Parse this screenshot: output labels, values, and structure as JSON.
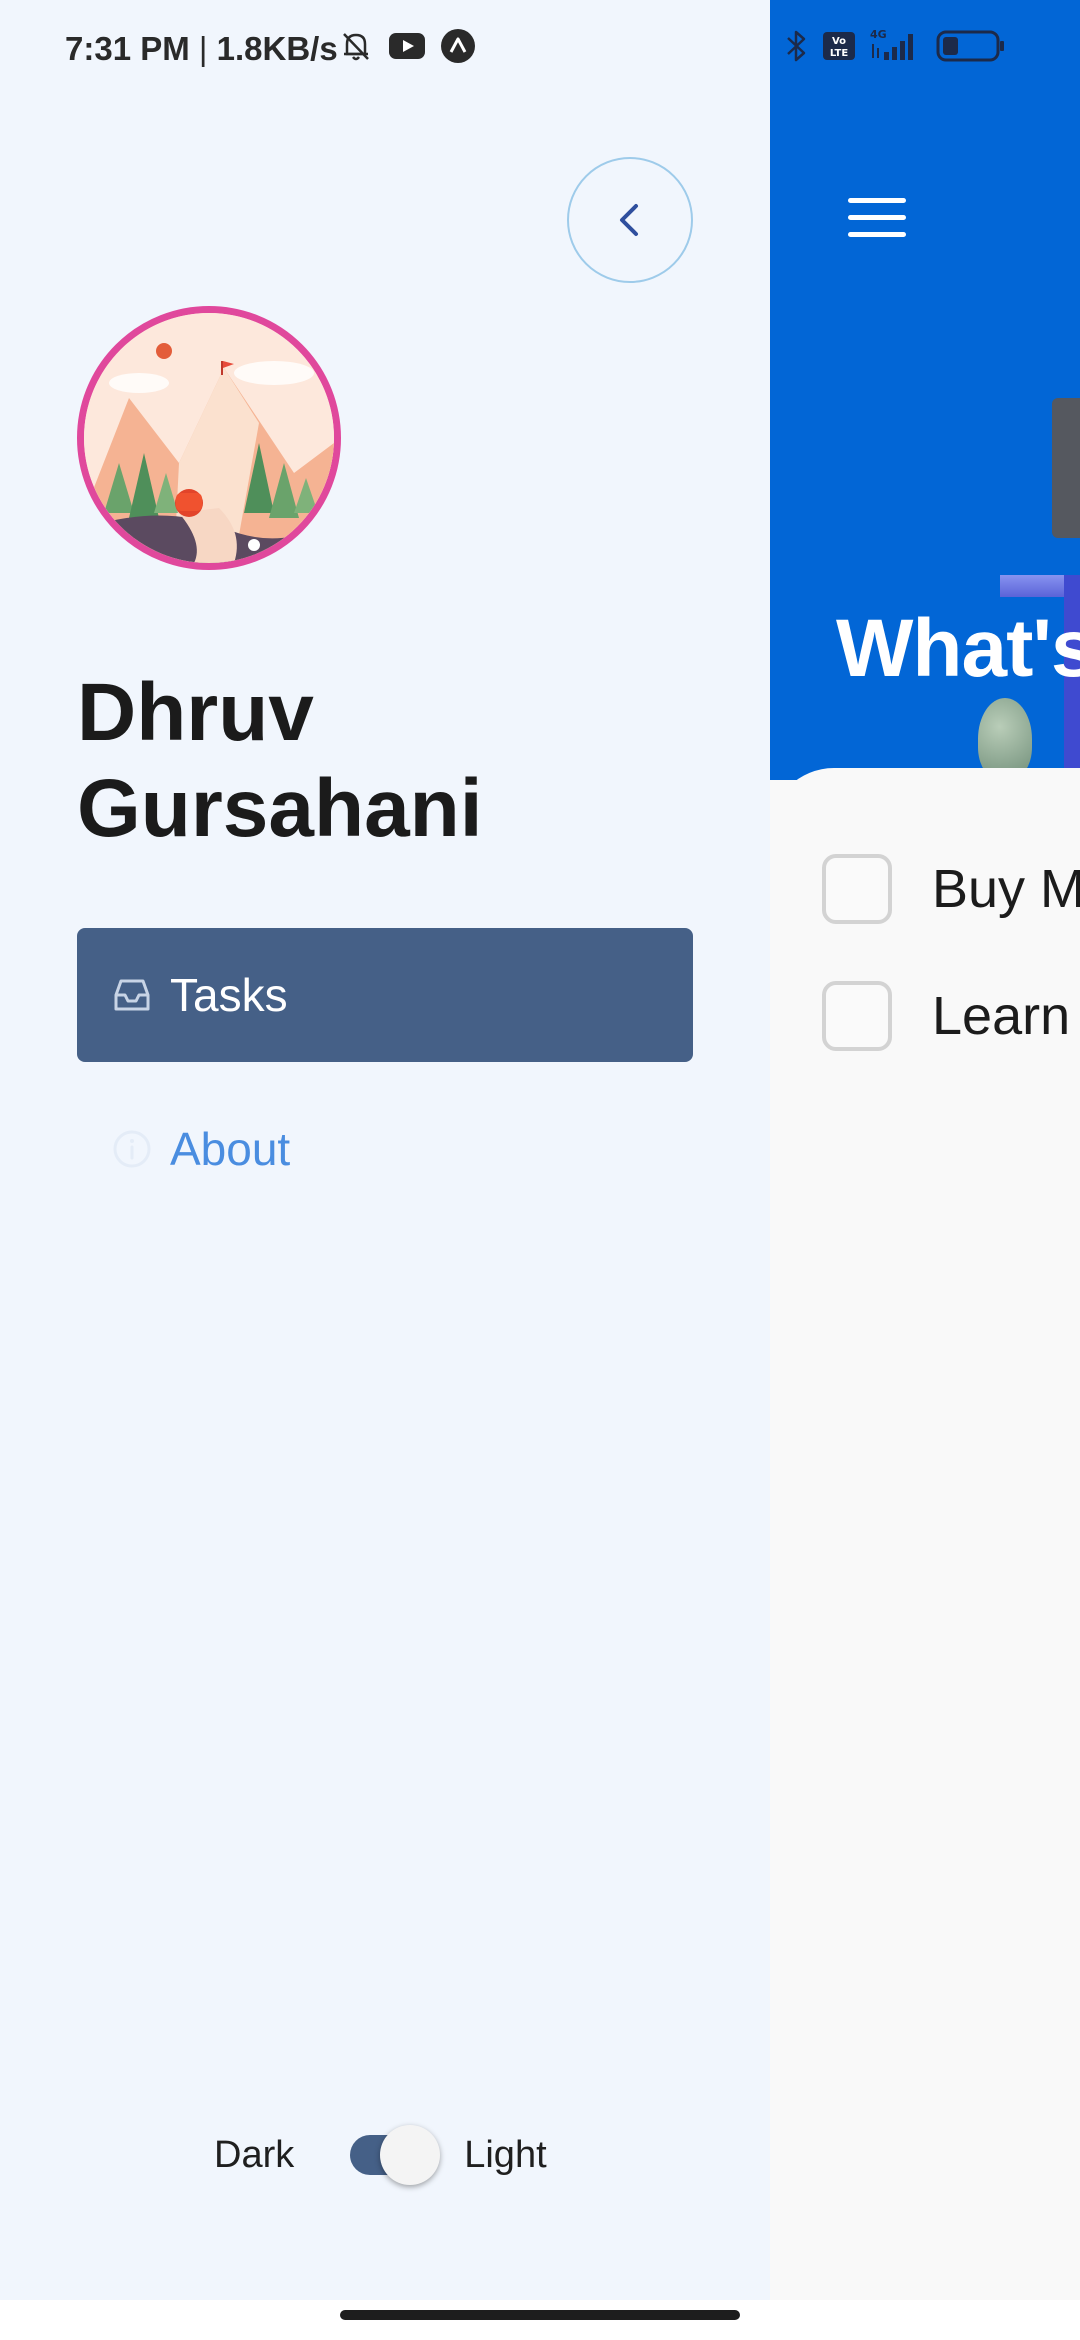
{
  "status_bar": {
    "time": "7:31 PM",
    "separator": "|",
    "network_speed": "1.8KB/s",
    "left_icons": [
      "bell-off-icon",
      "youtube-icon",
      "app-notification-icon"
    ],
    "right_icons": [
      "bluetooth-icon",
      "volte-icon",
      "signal-4g-icon",
      "battery-icon"
    ],
    "network_type": "4G",
    "volte_label": "Vo LTE",
    "battery_level": 0.3
  },
  "drawer": {
    "back_icon": "chevron-left-icon",
    "user_name": "Dhruv Gursahani",
    "nav_items": [
      {
        "label": "Tasks",
        "icon": "inbox-tray-icon",
        "active": true
      },
      {
        "label": "About",
        "icon": "info-icon",
        "active": false
      }
    ],
    "theme_toggle": {
      "left_label": "Dark",
      "right_label": "Light",
      "state": "light"
    }
  },
  "main": {
    "menu_icon": "hamburger-menu-icon",
    "header_title": "What's",
    "tasks": [
      {
        "label": "Buy Mo",
        "checked": false
      },
      {
        "label": "Learn",
        "checked": false
      }
    ]
  },
  "colors": {
    "drawer_bg": "#f1f6fd",
    "header_blue": "#0266d6",
    "active_nav": "#456087",
    "link_blue": "#4a8de0",
    "avatar_ring": "#e0489c"
  }
}
